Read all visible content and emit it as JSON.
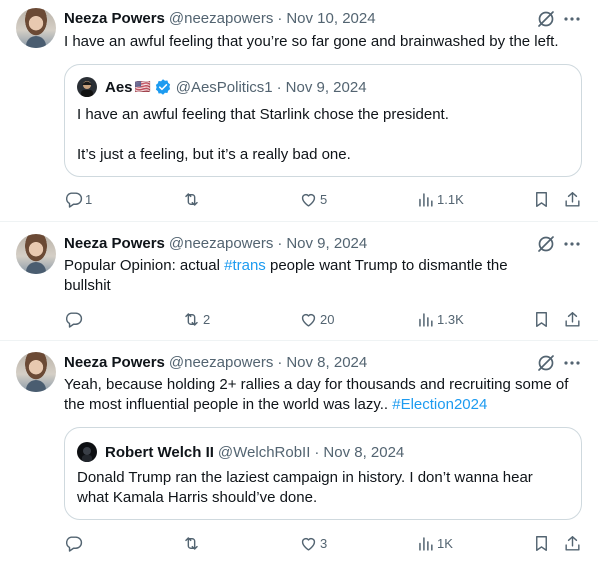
{
  "colors": {
    "text": "#0f1419",
    "secondary": "#536471",
    "link": "#1d9bf0",
    "border": "#cfd9de",
    "verified": "#1d9bf0"
  },
  "tweets": [
    {
      "author": "Neeza Powers",
      "handle": "@neezapowers",
      "separator": "·",
      "date": "Nov 10, 2024",
      "text": "I have an awful feeling that you’re so far gone and brainwashed by the left.",
      "quote": {
        "author": "Aes",
        "author_flag": "🇺🇸",
        "verified": true,
        "handle": "@AesPolitics1",
        "separator": "·",
        "date": "Nov 9, 2024",
        "line1": "I have an awful feeling that Starlink chose the president.",
        "line2": "It’s just a feeling, but it’s a really bad one."
      },
      "stats": {
        "replies": "1",
        "reposts": "",
        "likes": "5",
        "views": "1.1K"
      }
    },
    {
      "author": "Neeza Powers",
      "handle": "@neezapowers",
      "separator": "·",
      "date": "Nov 9, 2024",
      "text_before": "Popular Opinion:  actual ",
      "hashtag": "#trans",
      "text_after": " people want Trump to dismantle the bullshit",
      "stats": {
        "replies": "",
        "reposts": "2",
        "likes": "20",
        "views": "1.3K"
      }
    },
    {
      "author": "Neeza Powers",
      "handle": "@neezapowers",
      "separator": "·",
      "date": "Nov 8, 2024",
      "text_before": "Yeah, because holding 2+ rallies a day for thousands and recruiting some of the most influential people in the world was lazy.. ",
      "hashtag": "#Election2024",
      "quote": {
        "author": "Robert Welch II",
        "handle": "@WelchRobII",
        "separator": "·",
        "date": "Nov 8, 2024",
        "text": "Donald Trump ran the laziest campaign in history. I don’t wanna hear what Kamala Harris should’ve done."
      },
      "stats": {
        "replies": "",
        "reposts": "",
        "likes": "3",
        "views": "1K"
      }
    }
  ]
}
